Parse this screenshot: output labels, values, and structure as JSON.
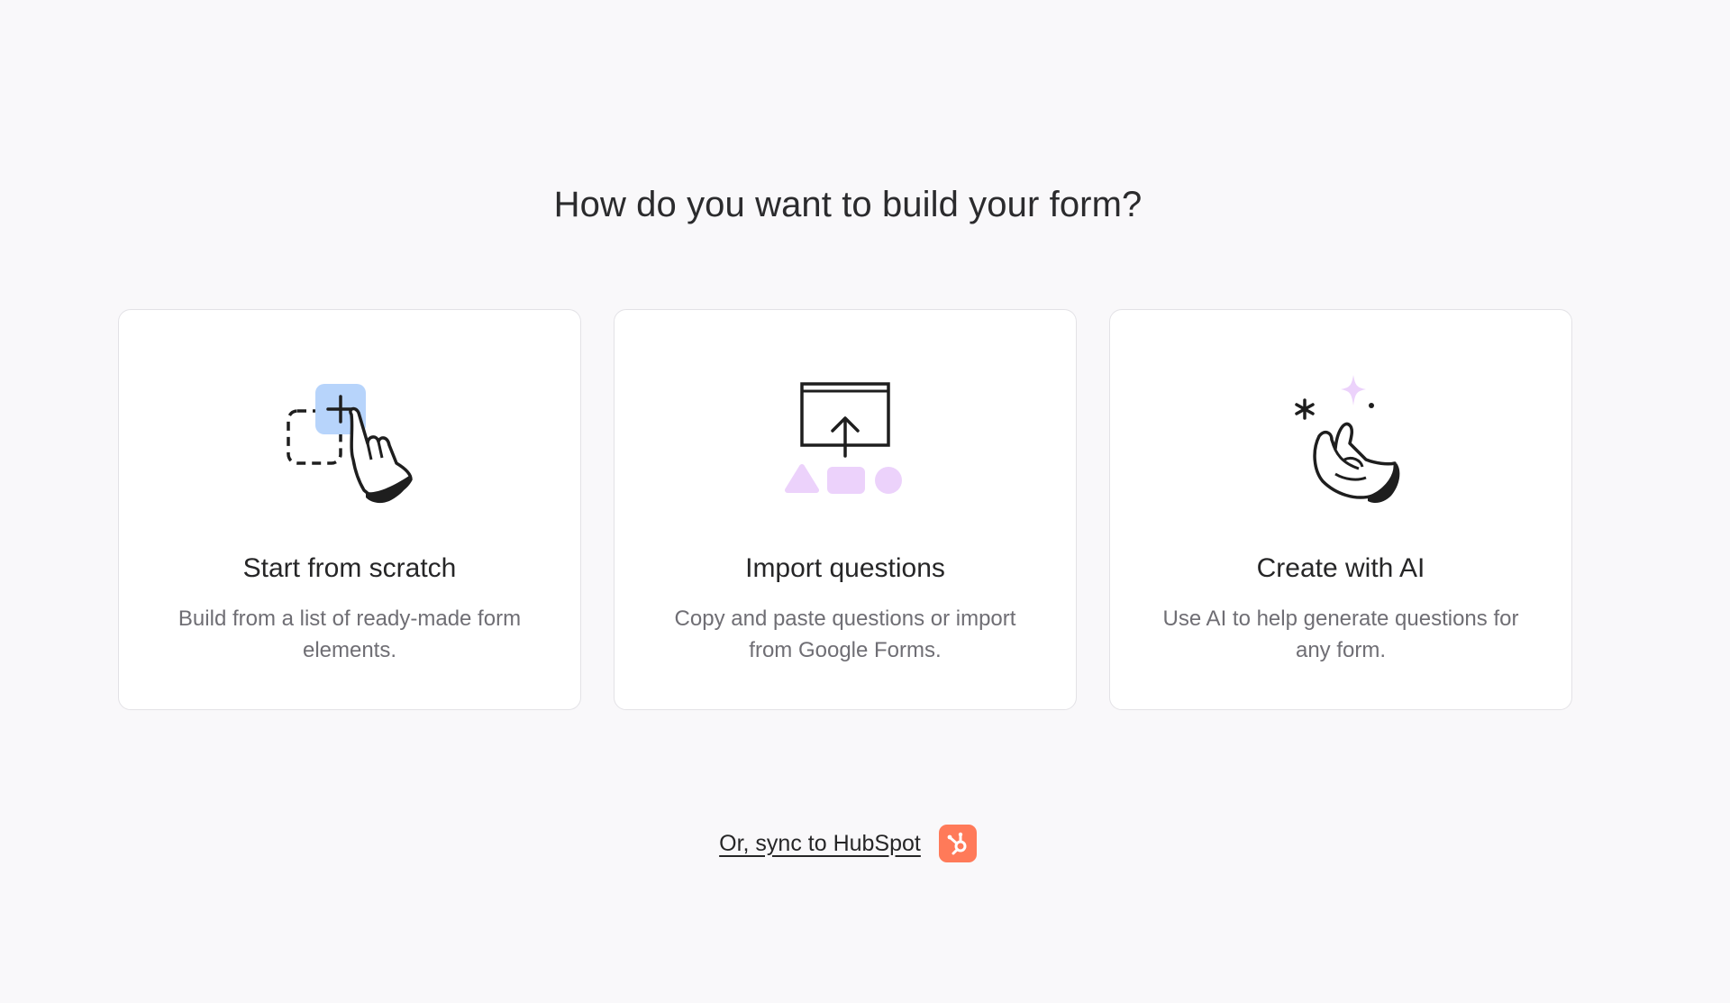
{
  "header": {
    "title": "How do you want to build your form?"
  },
  "cards": [
    {
      "title": "Start from scratch",
      "description": "Build from a list of ready-made form elements.",
      "icon": "hand-add-element-icon"
    },
    {
      "title": "Import questions",
      "description": "Copy and paste questions or import from Google Forms.",
      "icon": "upload-shapes-icon"
    },
    {
      "title": "Create with AI",
      "description": "Use AI to help generate questions for any form.",
      "icon": "snapping-hand-sparkle-icon"
    }
  ],
  "footer": {
    "sync_label": "Or, sync to HubSpot",
    "hubspot_icon": "hubspot-logo-icon"
  },
  "colors": {
    "background": "#f9f8fa",
    "card_background": "#ffffff",
    "card_border": "#e3e2e6",
    "accent_blue": "#b7d4fb",
    "accent_lilac": "#ecd2fb",
    "hubspot_orange": "#ff7a59"
  }
}
